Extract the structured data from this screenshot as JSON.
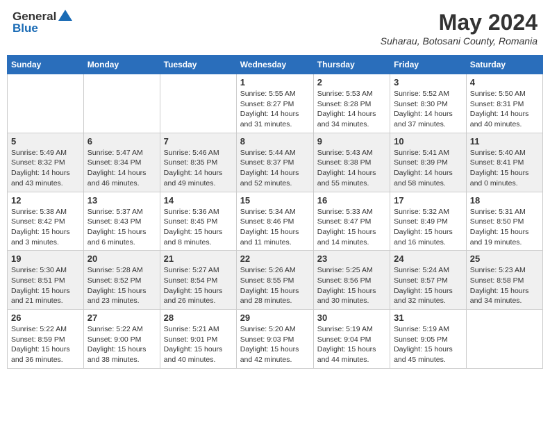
{
  "header": {
    "logo_general": "General",
    "logo_blue": "Blue",
    "month_year": "May 2024",
    "location": "Suharau, Botosani County, Romania"
  },
  "calendar": {
    "days_of_week": [
      "Sunday",
      "Monday",
      "Tuesday",
      "Wednesday",
      "Thursday",
      "Friday",
      "Saturday"
    ],
    "weeks": [
      [
        {
          "day": "",
          "sunrise": "",
          "sunset": "",
          "daylight": ""
        },
        {
          "day": "",
          "sunrise": "",
          "sunset": "",
          "daylight": ""
        },
        {
          "day": "",
          "sunrise": "",
          "sunset": "",
          "daylight": ""
        },
        {
          "day": "1",
          "sunrise": "Sunrise: 5:55 AM",
          "sunset": "Sunset: 8:27 PM",
          "daylight": "Daylight: 14 hours and 31 minutes."
        },
        {
          "day": "2",
          "sunrise": "Sunrise: 5:53 AM",
          "sunset": "Sunset: 8:28 PM",
          "daylight": "Daylight: 14 hours and 34 minutes."
        },
        {
          "day": "3",
          "sunrise": "Sunrise: 5:52 AM",
          "sunset": "Sunset: 8:30 PM",
          "daylight": "Daylight: 14 hours and 37 minutes."
        },
        {
          "day": "4",
          "sunrise": "Sunrise: 5:50 AM",
          "sunset": "Sunset: 8:31 PM",
          "daylight": "Daylight: 14 hours and 40 minutes."
        }
      ],
      [
        {
          "day": "5",
          "sunrise": "Sunrise: 5:49 AM",
          "sunset": "Sunset: 8:32 PM",
          "daylight": "Daylight: 14 hours and 43 minutes."
        },
        {
          "day": "6",
          "sunrise": "Sunrise: 5:47 AM",
          "sunset": "Sunset: 8:34 PM",
          "daylight": "Daylight: 14 hours and 46 minutes."
        },
        {
          "day": "7",
          "sunrise": "Sunrise: 5:46 AM",
          "sunset": "Sunset: 8:35 PM",
          "daylight": "Daylight: 14 hours and 49 minutes."
        },
        {
          "day": "8",
          "sunrise": "Sunrise: 5:44 AM",
          "sunset": "Sunset: 8:37 PM",
          "daylight": "Daylight: 14 hours and 52 minutes."
        },
        {
          "day": "9",
          "sunrise": "Sunrise: 5:43 AM",
          "sunset": "Sunset: 8:38 PM",
          "daylight": "Daylight: 14 hours and 55 minutes."
        },
        {
          "day": "10",
          "sunrise": "Sunrise: 5:41 AM",
          "sunset": "Sunset: 8:39 PM",
          "daylight": "Daylight: 14 hours and 58 minutes."
        },
        {
          "day": "11",
          "sunrise": "Sunrise: 5:40 AM",
          "sunset": "Sunset: 8:41 PM",
          "daylight": "Daylight: 15 hours and 0 minutes."
        }
      ],
      [
        {
          "day": "12",
          "sunrise": "Sunrise: 5:38 AM",
          "sunset": "Sunset: 8:42 PM",
          "daylight": "Daylight: 15 hours and 3 minutes."
        },
        {
          "day": "13",
          "sunrise": "Sunrise: 5:37 AM",
          "sunset": "Sunset: 8:43 PM",
          "daylight": "Daylight: 15 hours and 6 minutes."
        },
        {
          "day": "14",
          "sunrise": "Sunrise: 5:36 AM",
          "sunset": "Sunset: 8:45 PM",
          "daylight": "Daylight: 15 hours and 8 minutes."
        },
        {
          "day": "15",
          "sunrise": "Sunrise: 5:34 AM",
          "sunset": "Sunset: 8:46 PM",
          "daylight": "Daylight: 15 hours and 11 minutes."
        },
        {
          "day": "16",
          "sunrise": "Sunrise: 5:33 AM",
          "sunset": "Sunset: 8:47 PM",
          "daylight": "Daylight: 15 hours and 14 minutes."
        },
        {
          "day": "17",
          "sunrise": "Sunrise: 5:32 AM",
          "sunset": "Sunset: 8:49 PM",
          "daylight": "Daylight: 15 hours and 16 minutes."
        },
        {
          "day": "18",
          "sunrise": "Sunrise: 5:31 AM",
          "sunset": "Sunset: 8:50 PM",
          "daylight": "Daylight: 15 hours and 19 minutes."
        }
      ],
      [
        {
          "day": "19",
          "sunrise": "Sunrise: 5:30 AM",
          "sunset": "Sunset: 8:51 PM",
          "daylight": "Daylight: 15 hours and 21 minutes."
        },
        {
          "day": "20",
          "sunrise": "Sunrise: 5:28 AM",
          "sunset": "Sunset: 8:52 PM",
          "daylight": "Daylight: 15 hours and 23 minutes."
        },
        {
          "day": "21",
          "sunrise": "Sunrise: 5:27 AM",
          "sunset": "Sunset: 8:54 PM",
          "daylight": "Daylight: 15 hours and 26 minutes."
        },
        {
          "day": "22",
          "sunrise": "Sunrise: 5:26 AM",
          "sunset": "Sunset: 8:55 PM",
          "daylight": "Daylight: 15 hours and 28 minutes."
        },
        {
          "day": "23",
          "sunrise": "Sunrise: 5:25 AM",
          "sunset": "Sunset: 8:56 PM",
          "daylight": "Daylight: 15 hours and 30 minutes."
        },
        {
          "day": "24",
          "sunrise": "Sunrise: 5:24 AM",
          "sunset": "Sunset: 8:57 PM",
          "daylight": "Daylight: 15 hours and 32 minutes."
        },
        {
          "day": "25",
          "sunrise": "Sunrise: 5:23 AM",
          "sunset": "Sunset: 8:58 PM",
          "daylight": "Daylight: 15 hours and 34 minutes."
        }
      ],
      [
        {
          "day": "26",
          "sunrise": "Sunrise: 5:22 AM",
          "sunset": "Sunset: 8:59 PM",
          "daylight": "Daylight: 15 hours and 36 minutes."
        },
        {
          "day": "27",
          "sunrise": "Sunrise: 5:22 AM",
          "sunset": "Sunset: 9:00 PM",
          "daylight": "Daylight: 15 hours and 38 minutes."
        },
        {
          "day": "28",
          "sunrise": "Sunrise: 5:21 AM",
          "sunset": "Sunset: 9:01 PM",
          "daylight": "Daylight: 15 hours and 40 minutes."
        },
        {
          "day": "29",
          "sunrise": "Sunrise: 5:20 AM",
          "sunset": "Sunset: 9:03 PM",
          "daylight": "Daylight: 15 hours and 42 minutes."
        },
        {
          "day": "30",
          "sunrise": "Sunrise: 5:19 AM",
          "sunset": "Sunset: 9:04 PM",
          "daylight": "Daylight: 15 hours and 44 minutes."
        },
        {
          "day": "31",
          "sunrise": "Sunrise: 5:19 AM",
          "sunset": "Sunset: 9:05 PM",
          "daylight": "Daylight: 15 hours and 45 minutes."
        },
        {
          "day": "",
          "sunrise": "",
          "sunset": "",
          "daylight": ""
        }
      ]
    ]
  }
}
